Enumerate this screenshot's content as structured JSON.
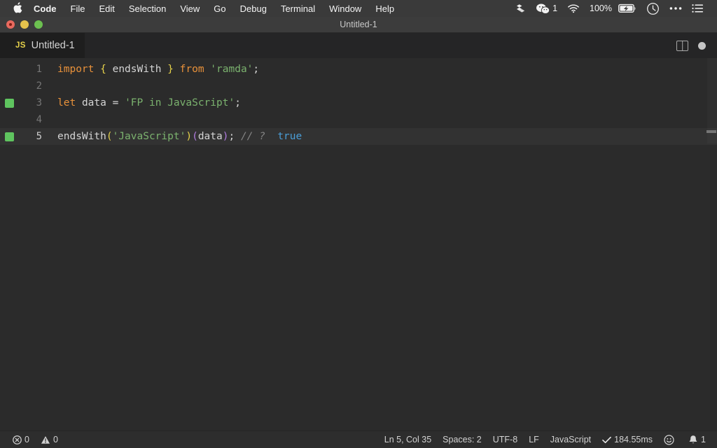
{
  "menubar": {
    "apple_icon": "apple-logo-icon",
    "items": [
      {
        "label": "Code",
        "bold": true
      },
      {
        "label": "File",
        "bold": false
      },
      {
        "label": "Edit",
        "bold": false
      },
      {
        "label": "Selection",
        "bold": false
      },
      {
        "label": "View",
        "bold": false
      },
      {
        "label": "Go",
        "bold": false
      },
      {
        "label": "Debug",
        "bold": false
      },
      {
        "label": "Terminal",
        "bold": false
      },
      {
        "label": "Window",
        "bold": false
      },
      {
        "label": "Help",
        "bold": false
      }
    ],
    "tray": {
      "dropbox_icon": "dropbox-icon",
      "wechat_icon": "wechat-icon",
      "wechat_badge": "1",
      "wifi_icon": "wifi-icon",
      "battery_percent": "100%",
      "battery_icon": "battery-charging-icon",
      "clock_icon": "clock-icon",
      "more_icon": "ellipsis-icon",
      "control_center_icon": "list-menu-icon"
    }
  },
  "window": {
    "title": "Untitled-1",
    "traffic_lights": {
      "close": "close-button",
      "minimize": "minimize-button",
      "maximize": "maximize-button"
    }
  },
  "tabbar": {
    "tabs": [
      {
        "badge": "JS",
        "label": "Untitled-1"
      }
    ],
    "actions": {
      "split_editor": "split-editor-icon",
      "unsaved_indicator": "unsaved-dot-icon"
    }
  },
  "editor": {
    "language": "JavaScript",
    "lines": [
      {
        "num": "1",
        "quokka": false,
        "active": false,
        "tokens": [
          {
            "text": "import",
            "cls": "t-key"
          },
          {
            "text": " ",
            "cls": "t-punct"
          },
          {
            "text": "{",
            "cls": "t-brace"
          },
          {
            "text": " ",
            "cls": "t-punct"
          },
          {
            "text": "endsWith",
            "cls": "t-ident"
          },
          {
            "text": " ",
            "cls": "t-punct"
          },
          {
            "text": "}",
            "cls": "t-brace"
          },
          {
            "text": " ",
            "cls": "t-punct"
          },
          {
            "text": "from",
            "cls": "t-key"
          },
          {
            "text": " ",
            "cls": "t-punct"
          },
          {
            "text": "'ramda'",
            "cls": "t-str"
          },
          {
            "text": ";",
            "cls": "t-semi"
          }
        ]
      },
      {
        "num": "2",
        "quokka": false,
        "active": false,
        "tokens": []
      },
      {
        "num": "3",
        "quokka": true,
        "active": false,
        "tokens": [
          {
            "text": "let",
            "cls": "t-key"
          },
          {
            "text": " ",
            "cls": "t-punct"
          },
          {
            "text": "data",
            "cls": "t-ident"
          },
          {
            "text": " ",
            "cls": "t-punct"
          },
          {
            "text": "=",
            "cls": "t-punct"
          },
          {
            "text": " ",
            "cls": "t-punct"
          },
          {
            "text": "'FP in JavaScript'",
            "cls": "t-str"
          },
          {
            "text": ";",
            "cls": "t-semi"
          }
        ]
      },
      {
        "num": "4",
        "quokka": false,
        "active": false,
        "tokens": []
      },
      {
        "num": "5",
        "quokka": true,
        "active": true,
        "tokens": [
          {
            "text": "endsWith",
            "cls": "t-ident"
          },
          {
            "text": "(",
            "cls": "t-paren1"
          },
          {
            "text": "'JavaScript'",
            "cls": "t-str"
          },
          {
            "text": ")",
            "cls": "t-paren1"
          },
          {
            "text": "(",
            "cls": "t-paren2"
          },
          {
            "text": "data",
            "cls": "t-ident"
          },
          {
            "text": ")",
            "cls": "t-paren2"
          },
          {
            "text": ";",
            "cls": "t-semi"
          },
          {
            "text": " ",
            "cls": "t-punct"
          },
          {
            "text": "// ?",
            "cls": "t-comment"
          },
          {
            "text": "  ",
            "cls": "t-punct"
          },
          {
            "text": "true",
            "cls": "t-val"
          }
        ]
      }
    ]
  },
  "statusbar": {
    "left": [
      {
        "icon": "error-icon",
        "label": "0"
      },
      {
        "icon": "warning-icon",
        "label": "0"
      }
    ],
    "right": [
      {
        "icon": null,
        "label": "Ln 5, Col 35"
      },
      {
        "icon": null,
        "label": "Spaces: 2"
      },
      {
        "icon": null,
        "label": "UTF-8"
      },
      {
        "icon": null,
        "label": "LF"
      },
      {
        "icon": null,
        "label": "JavaScript"
      },
      {
        "icon": "check-icon",
        "label": "184.55ms"
      },
      {
        "icon": "smiley-icon",
        "label": ""
      },
      {
        "icon": "bell-icon",
        "label": "1"
      }
    ]
  },
  "colors": {
    "menubar_bg": "#3a3a3a",
    "titlebar_bg": "#3c3c3c",
    "tabbar_bg": "#252526",
    "editor_bg": "#2b2b2b",
    "statusbar_bg": "#2d2d2d",
    "quokka_green": "#5fc45f",
    "js_yellow": "#e6d24a",
    "keyword_orange": "#e8913a",
    "string_green": "#7bb26e",
    "value_blue": "#4a9ed8"
  }
}
